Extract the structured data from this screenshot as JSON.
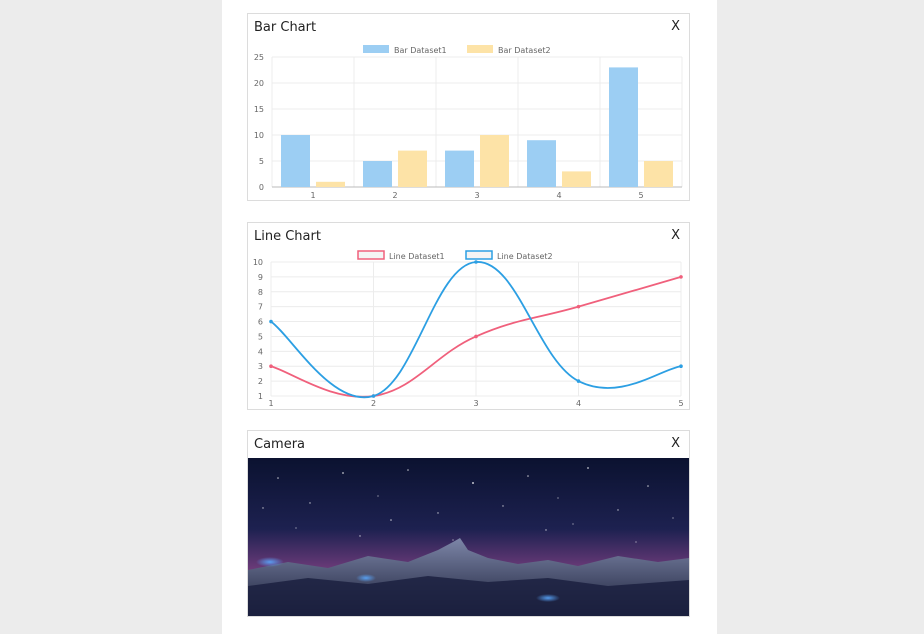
{
  "bar_card": {
    "title": "Bar Chart",
    "close_label": "X"
  },
  "line_card": {
    "title": "Line Chart",
    "close_label": "X"
  },
  "camera_card": {
    "title": "Camera",
    "close_label": "X"
  },
  "chart_data": [
    {
      "type": "bar",
      "title": "",
      "categories": [
        "1",
        "2",
        "3",
        "4",
        "5"
      ],
      "series": [
        {
          "name": "Bar Dataset1",
          "values": [
            10,
            5,
            7,
            9,
            23
          ],
          "color": "#9ccef3"
        },
        {
          "name": "Bar Dataset2",
          "values": [
            1,
            7,
            10,
            3,
            5
          ],
          "color": "#fde3a7"
        }
      ],
      "ylim": [
        0,
        25
      ],
      "yticks": [
        0,
        5,
        10,
        15,
        20,
        25
      ],
      "grid": true,
      "legend": "top-center"
    },
    {
      "type": "line",
      "title": "",
      "x": [
        "1",
        "2",
        "3",
        "4",
        "5"
      ],
      "series": [
        {
          "name": "Line Dataset1",
          "values": [
            3,
            1,
            5,
            7,
            9
          ],
          "color": "#f0607c"
        },
        {
          "name": "Line Dataset2",
          "values": [
            6,
            1,
            10,
            2,
            3
          ],
          "color": "#2c9fe3"
        }
      ],
      "ylim": [
        1,
        10
      ],
      "yticks": [
        1,
        2,
        3,
        4,
        5,
        6,
        7,
        8,
        9,
        10
      ],
      "grid": true,
      "legend": "top-center"
    }
  ]
}
